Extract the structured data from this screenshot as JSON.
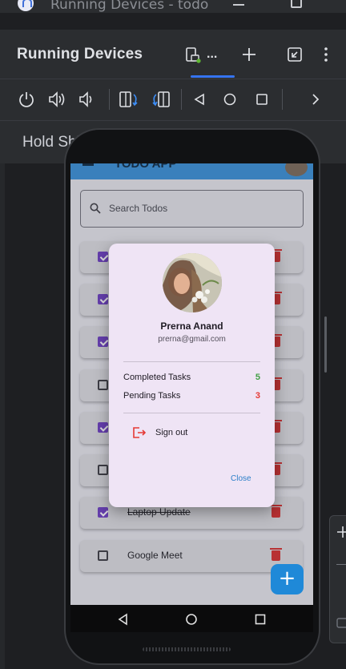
{
  "os_title": {
    "text": "Running Devices - todo"
  },
  "panel": {
    "title": "Running Devices",
    "device_tab": "...",
    "hint": "Hold Shift to control camera"
  },
  "icons": {
    "power": "power-icon",
    "volume_up": "volume-up-icon",
    "volume_down": "volume-down-icon",
    "rotate_left": "rotate-left-icon",
    "rotate_right": "rotate-right-icon",
    "back": "back-icon",
    "home": "home-icon",
    "overview": "overview-icon",
    "more": "chevron-right-icon"
  },
  "app": {
    "title": "TODO APP",
    "search_placeholder": "Search Todos",
    "todos": [
      {
        "label": "",
        "checked": true
      },
      {
        "label": "",
        "checked": true
      },
      {
        "label": "",
        "checked": true
      },
      {
        "label": "",
        "checked": false
      },
      {
        "label": "",
        "checked": true
      },
      {
        "label": "",
        "checked": false
      },
      {
        "label": "Laptop Update",
        "checked": true
      },
      {
        "label": "Google Meet",
        "checked": false
      }
    ],
    "fab_label": "+"
  },
  "dialog": {
    "name": "Prerna Anand",
    "email": "prerna@gmail.com",
    "completed_label": "Completed Tasks",
    "completed_value": "5",
    "pending_label": "Pending Tasks",
    "pending_value": "3",
    "signout_label": "Sign out",
    "close_label": "Close"
  },
  "colors": {
    "accent": "#3574f0",
    "completed": "#43a047",
    "pending": "#e53935",
    "appbar": "#3a8fd6"
  }
}
